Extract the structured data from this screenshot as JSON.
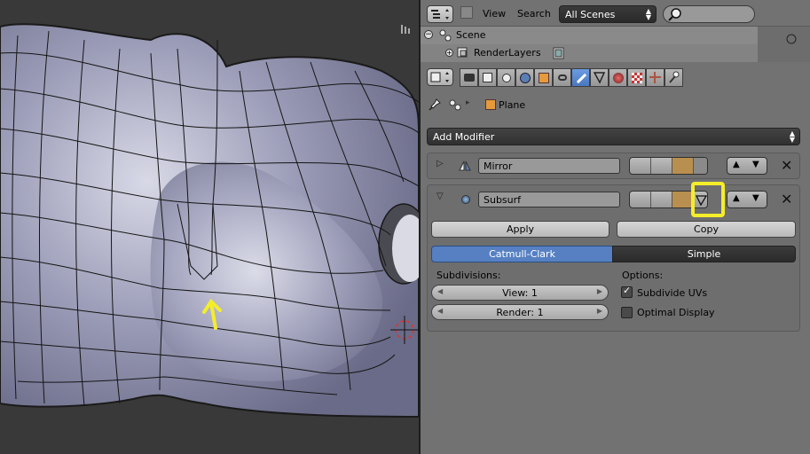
{
  "outliner": {
    "view_menu": "View",
    "search_menu": "Search",
    "scenes_dropdown": "All Scenes",
    "search_placeholder": "",
    "rows": [
      "Scene",
      "RenderLayers"
    ]
  },
  "properties": {
    "active_tab": "modifiers",
    "context_object": "Plane",
    "add_modifier_label": "Add Modifier",
    "modifiers": [
      {
        "name": "Mirror",
        "expanded": false
      },
      {
        "name": "Subsurf",
        "expanded": true
      }
    ],
    "subsurf": {
      "apply_label": "Apply",
      "copy_label": "Copy",
      "catmull_label": "Catmull-Clark",
      "simple_label": "Simple",
      "selected_type": "Catmull-Clark",
      "subdivisions_label": "Subdivisions:",
      "view_field": "View: 1",
      "render_field": "Render: 1",
      "options_label": "Options:",
      "subdivide_uvs_label": "Subdivide UVs",
      "subdivide_uvs_checked": true,
      "optimal_display_label": "Optimal Display",
      "optimal_display_checked": false
    }
  },
  "colors": {
    "accent_blue": "#5680c2",
    "highlight_yellow": "#f4ee2a",
    "mesh_surface": "#9a9bb5"
  }
}
